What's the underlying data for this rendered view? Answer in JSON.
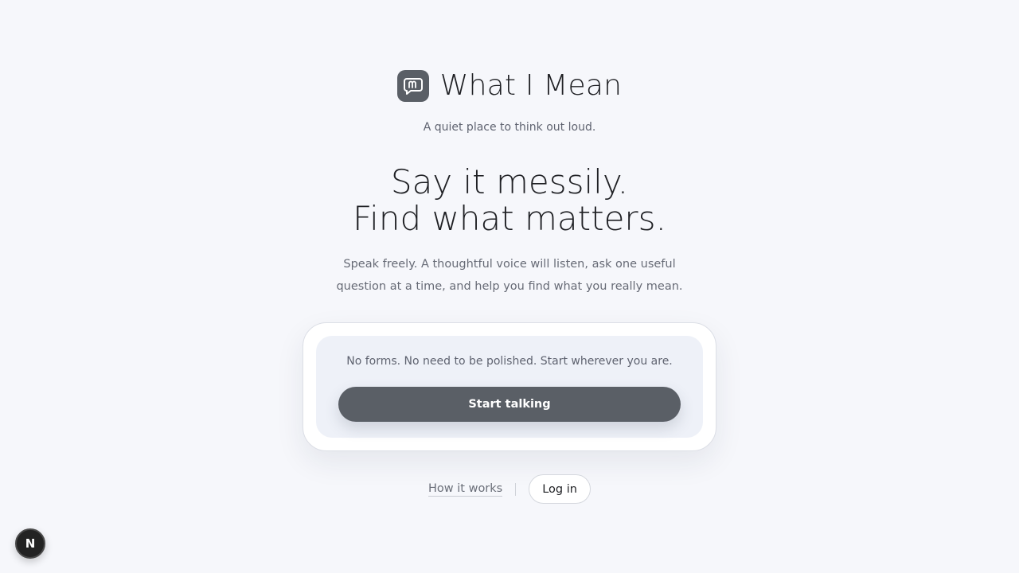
{
  "brand": {
    "name": "What I Mean",
    "tagline": "A quiet place to think out loud.",
    "logo_icon": "chat-bubble-m-icon",
    "logo_color": "#5a5f66"
  },
  "hero": {
    "headline_line1": "Say it messily.",
    "headline_line2": "Find what matters.",
    "intro": "Speak freely. A thoughtful voice will listen, ask one useful question at a time, and help you find what you really mean."
  },
  "card": {
    "note": "No forms. No need to be polished. Start wherever you are.",
    "start_label": "Start talking"
  },
  "footer": {
    "how_label": "How it works",
    "login_label": "Log in"
  },
  "dev_badge": {
    "label": "N",
    "icon": "nextjs-icon"
  },
  "colors": {
    "background": "#f6f7fb",
    "accent": "#5a5f66",
    "text": "#1f2024",
    "muted_text": "#5f6370"
  }
}
